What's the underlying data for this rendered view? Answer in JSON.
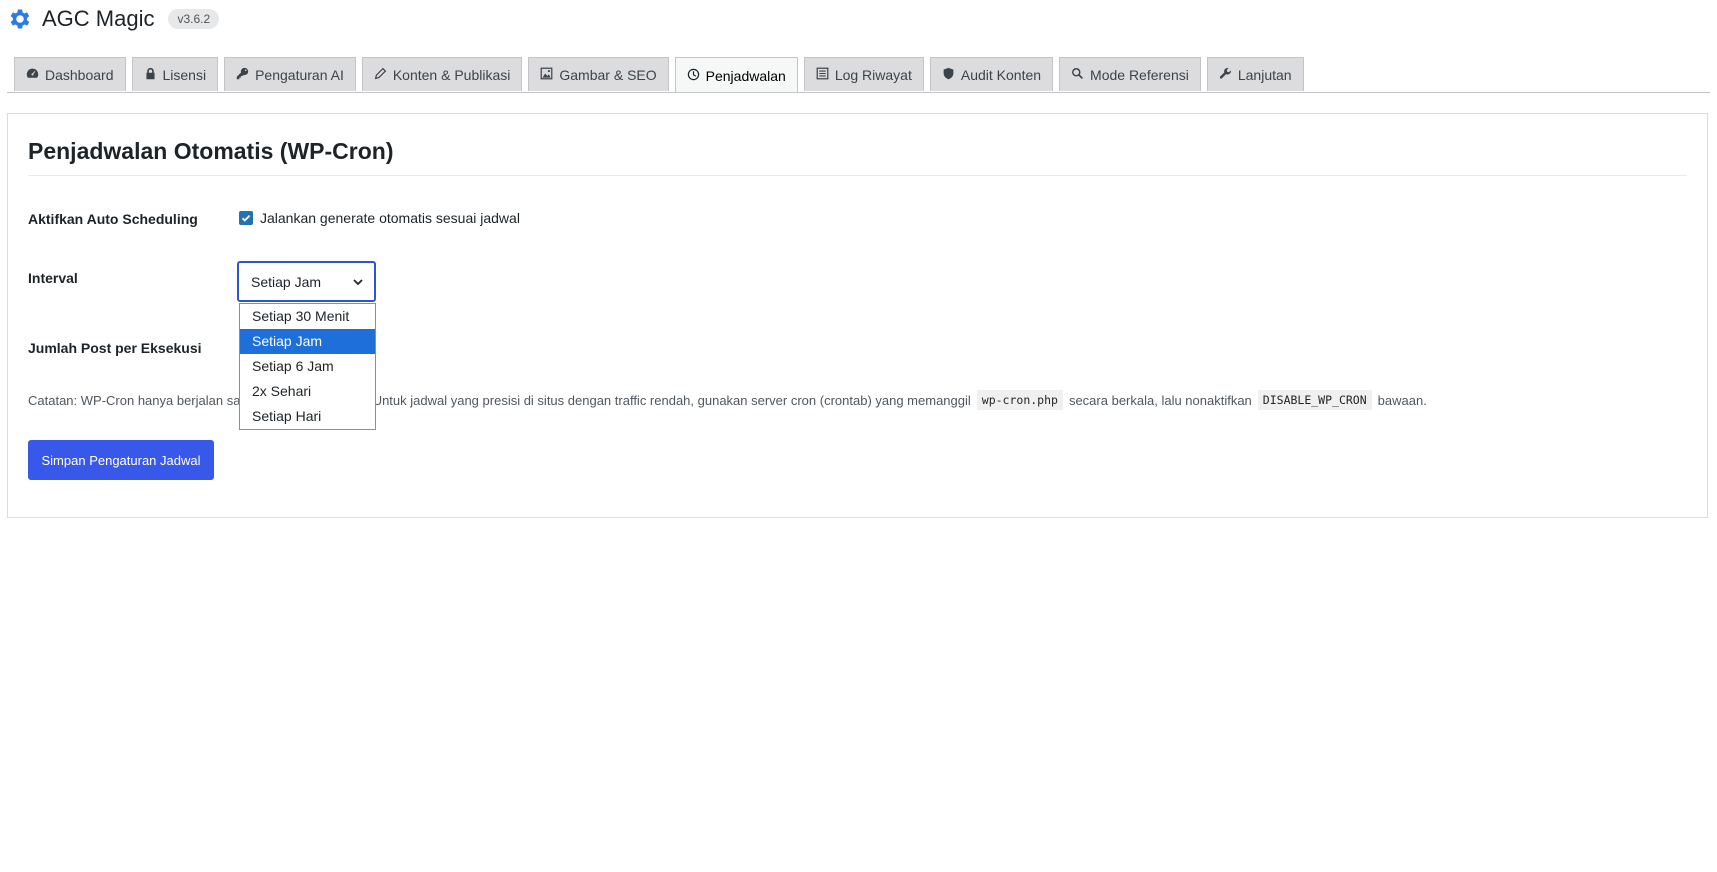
{
  "app": {
    "title": "AGC Magic",
    "version": "v3.6.2"
  },
  "tabs": [
    {
      "label": "Dashboard",
      "icon": "dashboard-icon"
    },
    {
      "label": "Lisensi",
      "icon": "lock-icon"
    },
    {
      "label": "Pengaturan AI",
      "icon": "key-icon"
    },
    {
      "label": "Konten & Publikasi",
      "icon": "pencil-icon"
    },
    {
      "label": "Gambar & SEO",
      "icon": "image-icon"
    },
    {
      "label": "Penjadwalan",
      "icon": "clock-icon",
      "active": true
    },
    {
      "label": "Log Riwayat",
      "icon": "list-icon"
    },
    {
      "label": "Audit Konten",
      "icon": "shield-icon"
    },
    {
      "label": "Mode Referensi",
      "icon": "search-icon"
    },
    {
      "label": "Lanjutan",
      "icon": "wrench-icon"
    }
  ],
  "panel": {
    "title": "Penjadwalan Otomatis (WP-Cron)",
    "auto_scheduling": {
      "label": "Aktifkan Auto Scheduling",
      "checkbox_label": "Jalankan generate otomatis sesuai jadwal",
      "checked": true
    },
    "interval": {
      "label": "Interval",
      "selected": "Setiap Jam",
      "options": [
        "Setiap 30 Menit",
        "Setiap Jam",
        "Setiap 6 Jam",
        "2x Sehari",
        "Setiap Hari"
      ]
    },
    "jumlah_post": {
      "label": "Jumlah Post per Eksekusi"
    },
    "note": {
      "part1": "Catatan: WP-Cron hanya berjalan saa",
      "part2": "Untuk jadwal yang presisi di situs dengan traffic rendah, gunakan server cron (crontab) yang memanggil",
      "code1": "wp-cron.php",
      "part3": "secara berkala, lalu nonaktifkan",
      "code2": "DISABLE_WP_CRON",
      "part4": "bawaan."
    },
    "save_button": "Simpan Pengaturan Jadwal"
  },
  "colors": {
    "accent": "#3858e9",
    "selected_option": "#1e6fd9",
    "checkbox": "#2271b1"
  }
}
